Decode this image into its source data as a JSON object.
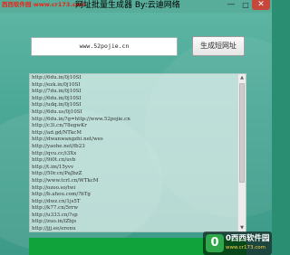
{
  "titlebar": {
    "watermark": "西西软件园 www.cr173.com",
    "title": "网址批量生成器 By:云迪网络",
    "minimize": "—",
    "maximize": "□",
    "close": "✕"
  },
  "form": {
    "url_value": "www.52pojie.cn",
    "generate_label": "生成短网址"
  },
  "results": [
    "http://6du.in/0j10SI",
    "http://ezk.in/0j10SI",
    "http://7du.in/0j10SI",
    "http://6du.in/0j10SI",
    "http://udq.in/0j10SI",
    "http://6du.us/0j10SI",
    "http://6du.in/?g=http://www.52pojie.cn",
    "http://c3l.cn/78egwKr",
    "http://ad.gd/NTkcM",
    "http://dwanwangzhi.net/wes",
    "http://yaohe.net/fb23",
    "http://qvu.cc/i3Xx",
    "http://9i0t.cn/uvb",
    "http://t.im/15yvv",
    "http://50r.cn/PaJbzZ",
    "http://www.tcrl.cn/WTkcM",
    "http://ozoo.so/twi",
    "http://b.ahou.com/?bTg",
    "http://dwz.cn/1js5T",
    "http://k77.cn/5rrw",
    "http://u333.cn/?sp",
    "http://zuo.in/iZbjs",
    "http://jjj.ee/erenu"
  ],
  "logo": {
    "mark": "0",
    "text": "0西西软件园",
    "sub": "www.cr173.com"
  }
}
